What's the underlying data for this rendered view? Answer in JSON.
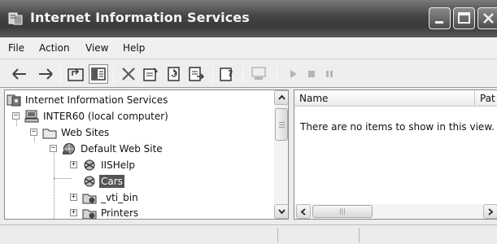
{
  "window": {
    "title": "Internet Information Services"
  },
  "titlebar": {
    "icon": "iis-app-icon",
    "buttons": [
      "minimize-icon",
      "maximize-icon",
      "close-icon"
    ]
  },
  "menu": {
    "items": [
      "File",
      "Action",
      "View",
      "Help"
    ]
  },
  "toolbar": {
    "icons": [
      "back-arrow-icon",
      "forward-arrow-icon",
      "up-folder-icon",
      "show-hide-tree-icon",
      "delete-icon",
      "properties-icon",
      "refresh-icon",
      "export-list-icon",
      "help-icon",
      "computer-icon",
      "play-icon",
      "stop-icon",
      "pause-icon"
    ]
  },
  "tree": {
    "items": [
      {
        "label": "Internet Information Services",
        "icon": "iis-root-icon"
      },
      {
        "label": "INTER60 (local computer)",
        "icon": "computer-icon"
      },
      {
        "label": "Web Sites",
        "icon": "folder-icon"
      },
      {
        "label": "Default Web Site",
        "icon": "website-globe-icon"
      },
      {
        "label": "IISHelp",
        "icon": "virtual-directory-icon"
      },
      {
        "label": "Cars",
        "icon": "virtual-directory-icon",
        "selected": true
      },
      {
        "label": "_vti_bin",
        "icon": "web-folder-icon"
      },
      {
        "label": "Printers",
        "icon": "web-folder-icon"
      }
    ]
  },
  "list": {
    "columns": [
      "Name",
      "Pat"
    ],
    "empty_message": "There are no items to show in this view."
  },
  "colors": {
    "titlebar": "#474747",
    "selection": "#555555",
    "window_bg": "#ececec"
  }
}
